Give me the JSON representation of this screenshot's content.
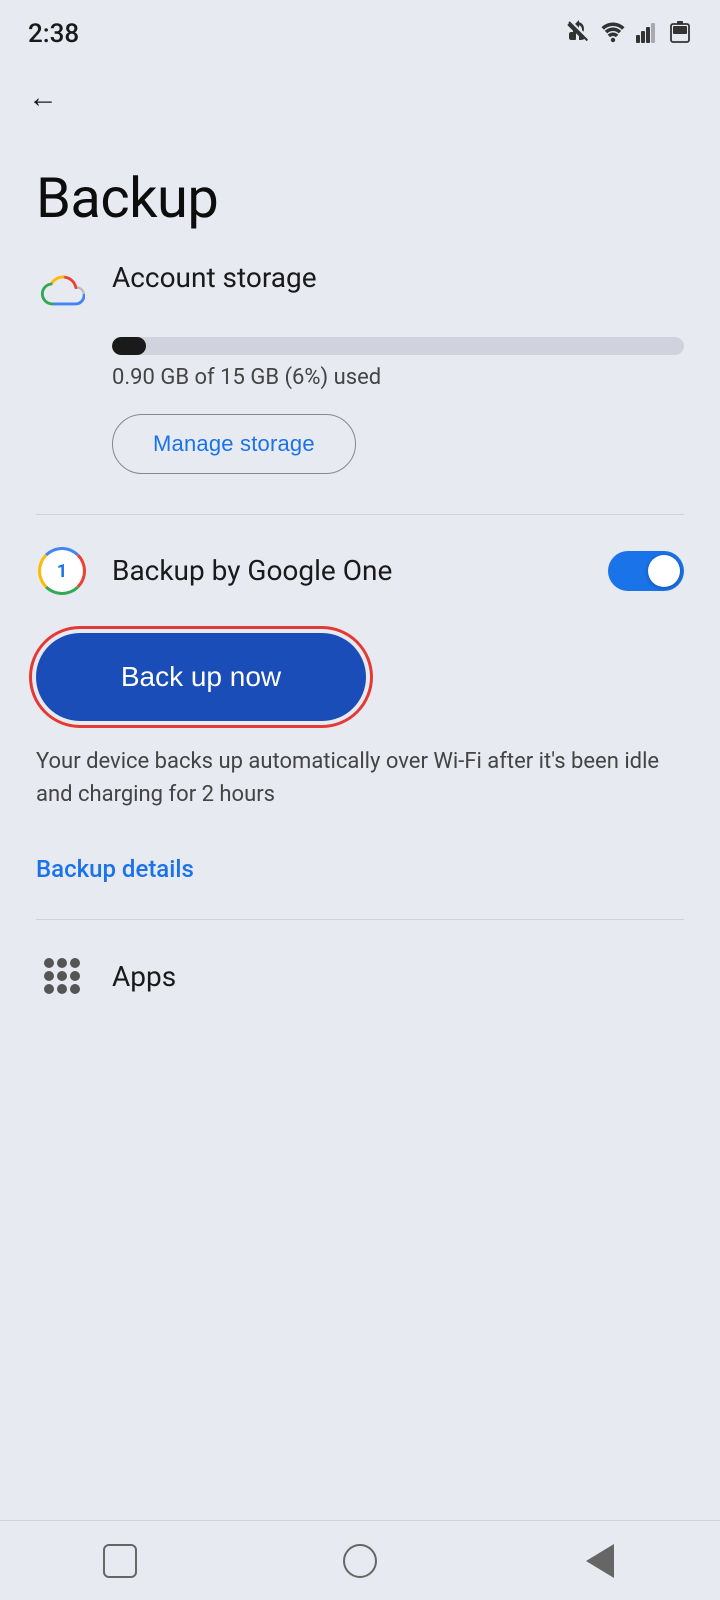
{
  "status": {
    "time": "2:38",
    "icons": [
      "mute",
      "wifi",
      "signal",
      "battery"
    ]
  },
  "nav": {
    "back_label": "←"
  },
  "page": {
    "title": "Backup"
  },
  "account_storage": {
    "label": "Account storage",
    "used_gb": "0.90",
    "total_gb": "15",
    "percent_used": "6",
    "storage_text": "0.90 GB of 15 GB (6%) used",
    "fill_percent": 6,
    "manage_btn_label": "Manage storage"
  },
  "backup_google_one": {
    "label": "Backup by Google One",
    "toggle_on": true
  },
  "back_up_now": {
    "label": "Back up now"
  },
  "auto_backup_desc": {
    "text": "Your device backs up automatically over Wi-Fi after it's been idle and charging for 2 hours"
  },
  "backup_details": {
    "label": "Backup details"
  },
  "apps": {
    "label": "Apps"
  },
  "bottom_nav": {
    "square_label": "Recent apps",
    "circle_label": "Home",
    "back_label": "Back"
  }
}
